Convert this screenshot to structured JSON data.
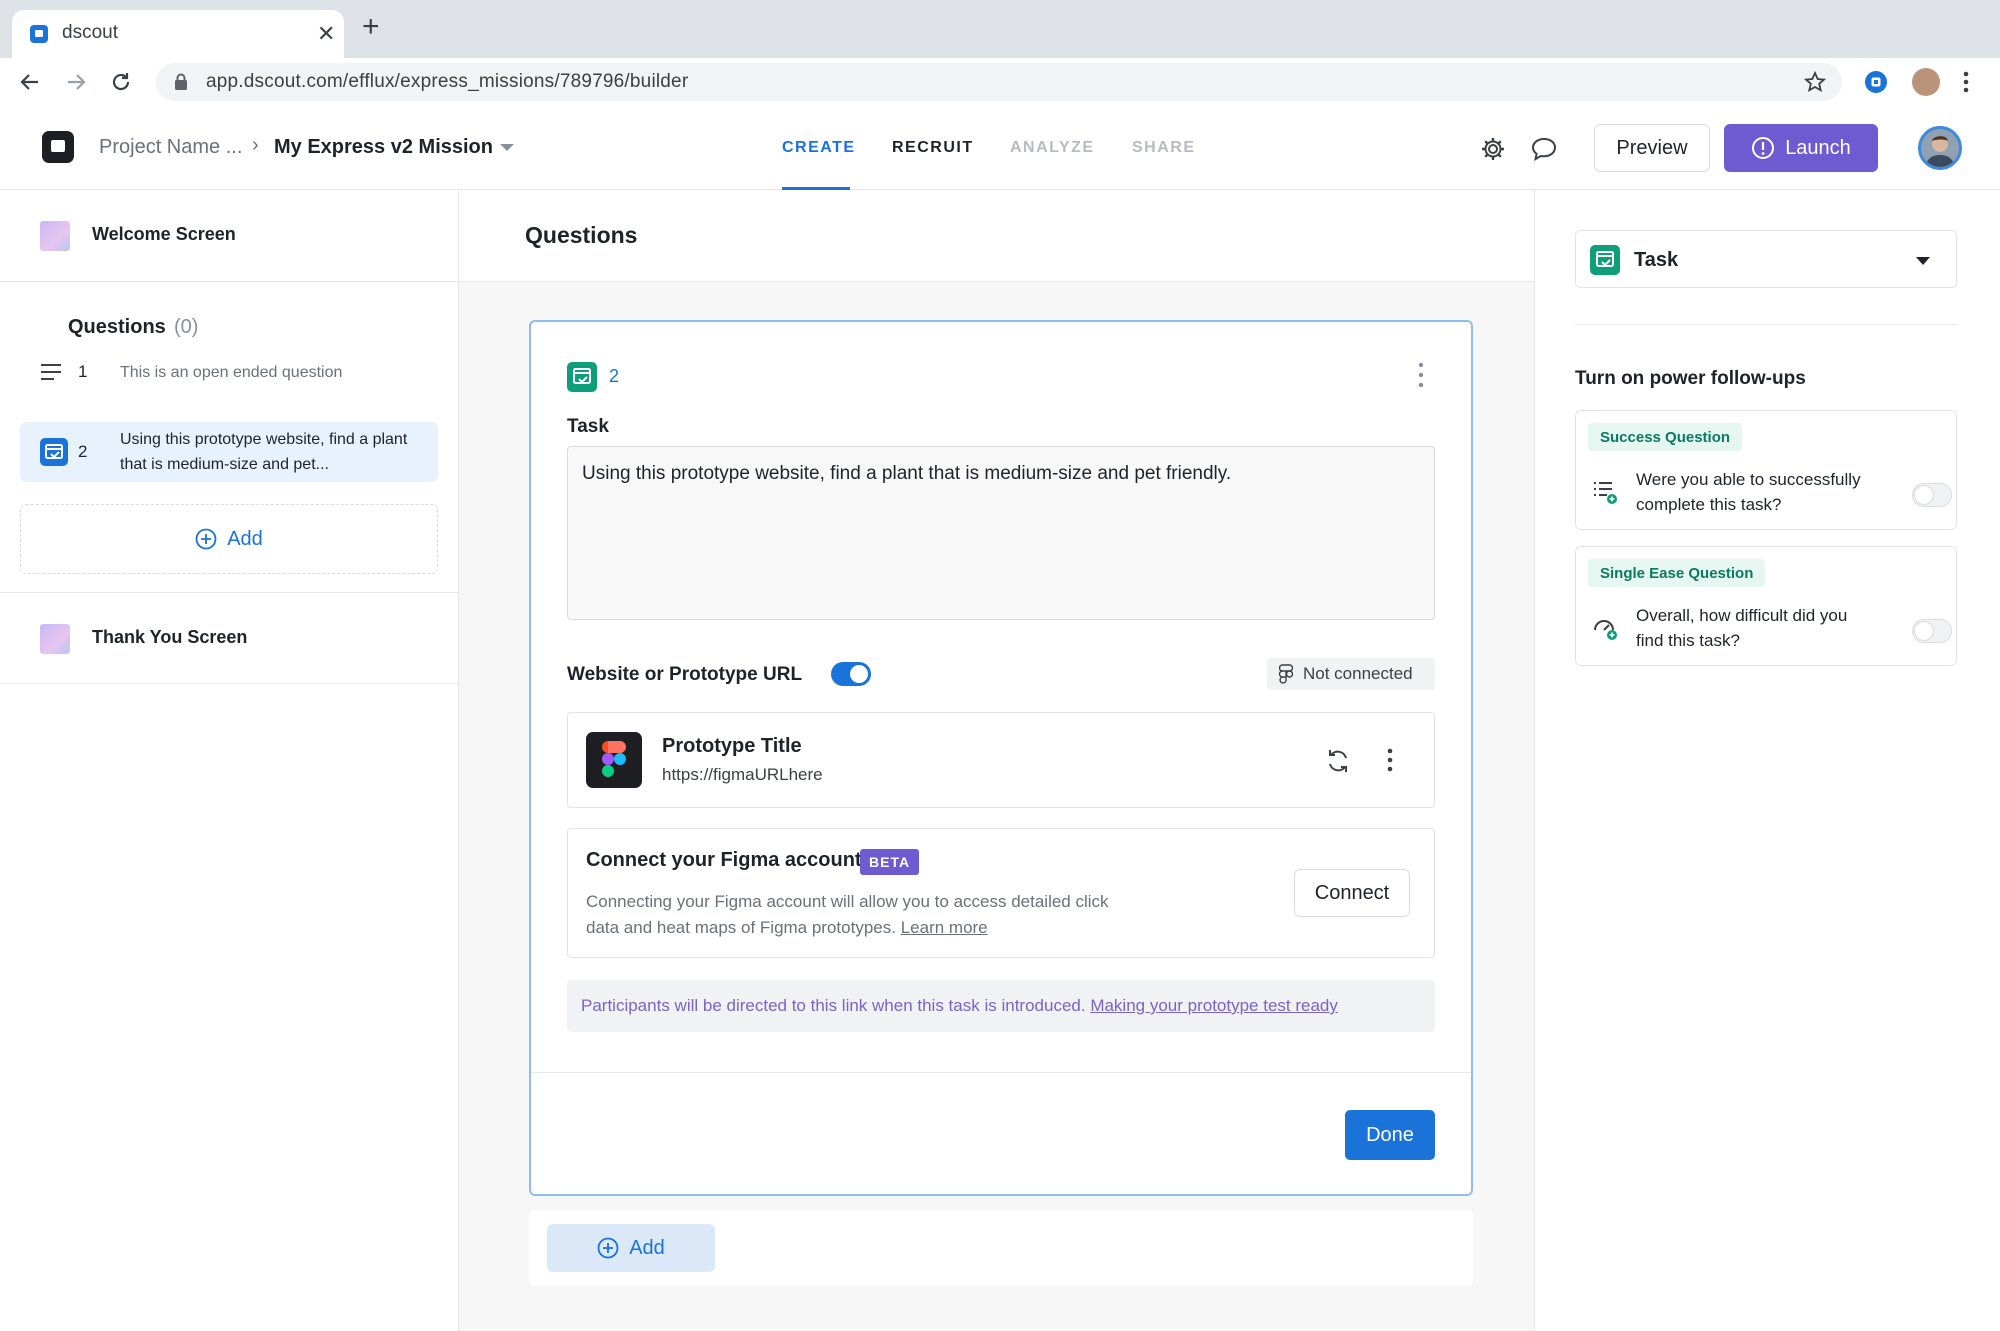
{
  "browser": {
    "tab_title": "dscout",
    "url": "app.dscout.com/efflux/express_missions/789796/builder"
  },
  "header": {
    "breadcrumb_project": "Project Name ...",
    "breadcrumb_separator": "›",
    "mission_name": "My Express v2 Mission",
    "tabs": [
      {
        "label": "CREATE",
        "state": "active"
      },
      {
        "label": "RECRUIT",
        "state": "enabled"
      },
      {
        "label": "ANALYZE",
        "state": "disabled"
      },
      {
        "label": "SHARE",
        "state": "disabled"
      }
    ],
    "preview_label": "Preview",
    "launch_label": "Launch"
  },
  "sidebar": {
    "welcome_label": "Welcome Screen",
    "questions_heading": "Questions",
    "questions_count": "(0)",
    "items": [
      {
        "number": "1",
        "text": "This is an open ended question",
        "icon": "text-lines-icon"
      },
      {
        "number": "2",
        "text": "Using this prototype website, find a plant that is medium-size and pet...",
        "icon": "task-icon",
        "selected": true
      }
    ],
    "add_label": "Add",
    "thank_you_label": "Thank You Screen"
  },
  "main": {
    "title": "Questions",
    "card": {
      "number": "2",
      "task_label": "Task",
      "task_text": "Using this prototype website, find a plant that is medium-size and pet friendly.",
      "url_label": "Website or Prototype URL",
      "url_toggle_on": true,
      "connection_status": "Not connected",
      "prototype_title": "Prototype Title",
      "prototype_url": "https://figmaURLhere",
      "figma_title": "Connect your Figma account",
      "beta_label": "BETA",
      "figma_desc": "Connecting your Figma account will allow you to access detailed click data and heat maps of Figma prototypes.",
      "learn_more": "Learn more",
      "connect_label": "Connect",
      "note_text": "Participants will be directed to this link when this task is introduced.",
      "note_link": "Making your prototype test ready",
      "done_label": "Done"
    },
    "add_label": "Add"
  },
  "right_panel": {
    "type_label": "Task",
    "followups_title": "Turn on power follow-ups",
    "followups": [
      {
        "badge": "Success Question",
        "text": "Were you able to successfully complete this task?",
        "enabled": false
      },
      {
        "badge": "Single Ease Question",
        "text": "Overall, how difficult did you find this task?",
        "enabled": false
      }
    ]
  },
  "colors": {
    "accent_blue": "#1a73d9",
    "launch_purple": "#6e5bd1",
    "task_green": "#0e9e79"
  }
}
